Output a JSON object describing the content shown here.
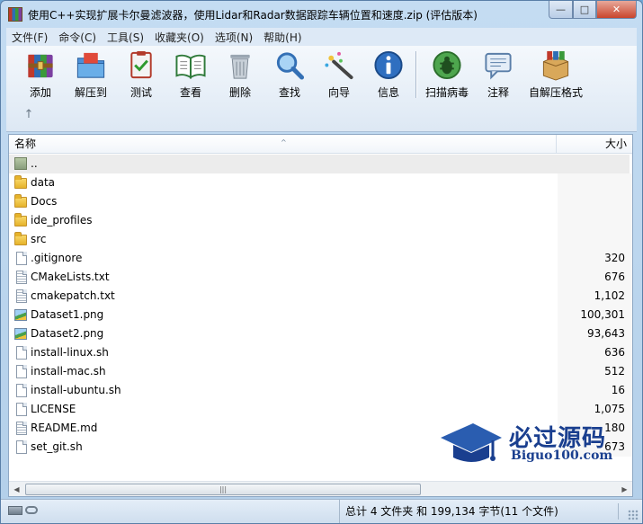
{
  "window": {
    "title": "使用C++实现扩展卡尔曼滤波器，使用Lidar和Radar数据跟踪车辆位置和速度.zip (评估版本)",
    "controls": {
      "minimize": "—",
      "maximize": "□",
      "close": "✕"
    }
  },
  "menu": [
    {
      "label": "文件(F)"
    },
    {
      "label": "命令(C)"
    },
    {
      "label": "工具(S)"
    },
    {
      "label": "收藏夹(O)"
    },
    {
      "label": "选项(N)"
    },
    {
      "label": "帮助(H)"
    }
  ],
  "toolbar": [
    {
      "label": "添加",
      "icon": "add-archive-icon"
    },
    {
      "label": "解压到",
      "icon": "extract-to-icon"
    },
    {
      "label": "测试",
      "icon": "test-icon"
    },
    {
      "label": "查看",
      "icon": "view-book-icon"
    },
    {
      "label": "删除",
      "icon": "trash-icon"
    },
    {
      "label": "查找",
      "icon": "magnifier-icon"
    },
    {
      "label": "向导",
      "icon": "wizard-wand-icon"
    },
    {
      "label": "信息",
      "icon": "info-icon"
    },
    {
      "label": "扫描病毒",
      "icon": "virus-scan-icon"
    },
    {
      "label": "注释",
      "icon": "comment-icon"
    },
    {
      "label": "自解压格式",
      "icon": "sfx-box-icon"
    }
  ],
  "up_button": "↑",
  "columns": {
    "name": "名称",
    "size": "大小",
    "sort_caret": "^"
  },
  "files": [
    {
      "name": "..",
      "size": "",
      "type": "parent"
    },
    {
      "name": "data",
      "size": "",
      "type": "folder"
    },
    {
      "name": "Docs",
      "size": "",
      "type": "folder"
    },
    {
      "name": "ide_profiles",
      "size": "",
      "type": "folder"
    },
    {
      "name": "src",
      "size": "",
      "type": "folder"
    },
    {
      "name": ".gitignore",
      "size": "320",
      "type": "file"
    },
    {
      "name": "CMakeLists.txt",
      "size": "676",
      "type": "text"
    },
    {
      "name": "cmakepatch.txt",
      "size": "1,102",
      "type": "text"
    },
    {
      "name": "Dataset1.png",
      "size": "100,301",
      "type": "image"
    },
    {
      "name": "Dataset2.png",
      "size": "93,643",
      "type": "image"
    },
    {
      "name": "install-linux.sh",
      "size": "636",
      "type": "file"
    },
    {
      "name": "install-mac.sh",
      "size": "512",
      "type": "file"
    },
    {
      "name": "install-ubuntu.sh",
      "size": "16",
      "type": "file"
    },
    {
      "name": "LICENSE",
      "size": "1,075",
      "type": "file"
    },
    {
      "name": "README.md",
      "size": "180",
      "type": "text"
    },
    {
      "name": "set_git.sh",
      "size": "673",
      "type": "file"
    }
  ],
  "scrollbar": {
    "left": "◀",
    "right": "▶",
    "grip": "|||"
  },
  "status": {
    "summary": "总计 4 文件夹 和 199,134 字节(11 个文件)"
  },
  "watermark": {
    "cn": "必过源码",
    "en": "Biguo100.com"
  },
  "colors": {
    "accent": "#1a3f8f",
    "folder": "#e6b32a",
    "titlebar": "#c4dcf2"
  }
}
